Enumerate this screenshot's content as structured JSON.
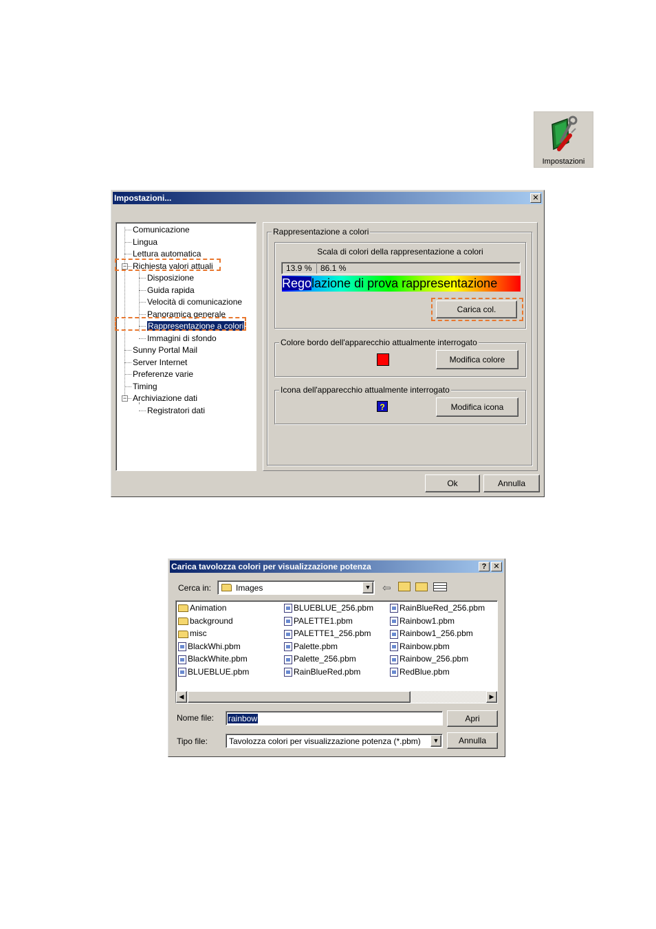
{
  "desktop_icon": {
    "label": "Impostazioni"
  },
  "settings_dialog": {
    "title": "Impostazioni...",
    "close_glyph": "✕",
    "tree": [
      {
        "label": "Comunicazione",
        "level": 0
      },
      {
        "label": "Lingua",
        "level": 0
      },
      {
        "label": "Lettura automatica",
        "level": 0
      },
      {
        "label": "Richiesta valori attuali",
        "level": 0,
        "expander": "−"
      },
      {
        "label": "Disposizione",
        "level": 1
      },
      {
        "label": "Guida rapida",
        "level": 1
      },
      {
        "label": "Velocità di comunicazione",
        "level": 1
      },
      {
        "label": "Panoramica generale",
        "level": 1
      },
      {
        "label": "Rappresentazione a colori",
        "level": 1,
        "selected": true
      },
      {
        "label": "Immagini di sfondo",
        "level": 1
      },
      {
        "label": "Sunny Portal Mail",
        "level": 0
      },
      {
        "label": "Server Internet",
        "level": 0
      },
      {
        "label": "Preferenze varie",
        "level": 0
      },
      {
        "label": "Timing",
        "level": 0
      },
      {
        "label": "Archiviazione dati",
        "level": 0,
        "expander": "−"
      },
      {
        "label": "Registratori dati",
        "level": 1
      }
    ],
    "group_main": "Rappresentazione a colori",
    "scale_title": "Scala di colori della rappresentazione a colori",
    "pct_left": "13.9 %",
    "pct_right": "86.1 %",
    "preview_text_a": "Rego",
    "preview_text_b": "lazione di prova rappresentazione",
    "load_button": "Carica col.",
    "border_group": "Colore bordo dell'apparecchio attualmente interrogato",
    "border_color": "#ff0000",
    "modify_color_button": "Modifica colore",
    "icon_group": "Icona dell'apparecchio attualmente interrogato",
    "icon_glyph": "?",
    "modify_icon_button": "Modifica icona",
    "ok_button": "Ok",
    "cancel_button": "Annulla"
  },
  "file_dialog": {
    "title": "Carica tavolozza colori per visualizzazione potenza",
    "help_glyph": "?",
    "close_glyph": "✕",
    "look_in_label": "Cerca in:",
    "look_in_value": "Images",
    "files": [
      {
        "name": "Animation",
        "type": "folder"
      },
      {
        "name": "background",
        "type": "folder"
      },
      {
        "name": "misc",
        "type": "folder"
      },
      {
        "name": "BlackWhi.pbm",
        "type": "file"
      },
      {
        "name": "BlackWhite.pbm",
        "type": "file"
      },
      {
        "name": "BLUEBLUE.pbm",
        "type": "file"
      },
      {
        "name": "BLUEBLUE_256.pbm",
        "type": "file"
      },
      {
        "name": "PALETTE1.pbm",
        "type": "file"
      },
      {
        "name": "PALETTE1_256.pbm",
        "type": "file"
      },
      {
        "name": "Palette.pbm",
        "type": "file"
      },
      {
        "name": "Palette_256.pbm",
        "type": "file"
      },
      {
        "name": "RainBlueRed.pbm",
        "type": "file"
      },
      {
        "name": "RainBlueRed_256.pbm",
        "type": "file"
      },
      {
        "name": "Rainbow1.pbm",
        "type": "file"
      },
      {
        "name": "Rainbow1_256.pbm",
        "type": "file"
      },
      {
        "name": "Rainbow.pbm",
        "type": "file"
      },
      {
        "name": "Rainbow_256.pbm",
        "type": "file"
      },
      {
        "name": "RedBlue.pbm",
        "type": "file"
      }
    ],
    "filename_label": "Nome file:",
    "filename_value": "rainbow",
    "filetype_label": "Tipo file:",
    "filetype_value": "Tavolozza colori per visualizzazione potenza (*.pbm)",
    "open_button": "Apri",
    "cancel_button": "Annulla"
  }
}
